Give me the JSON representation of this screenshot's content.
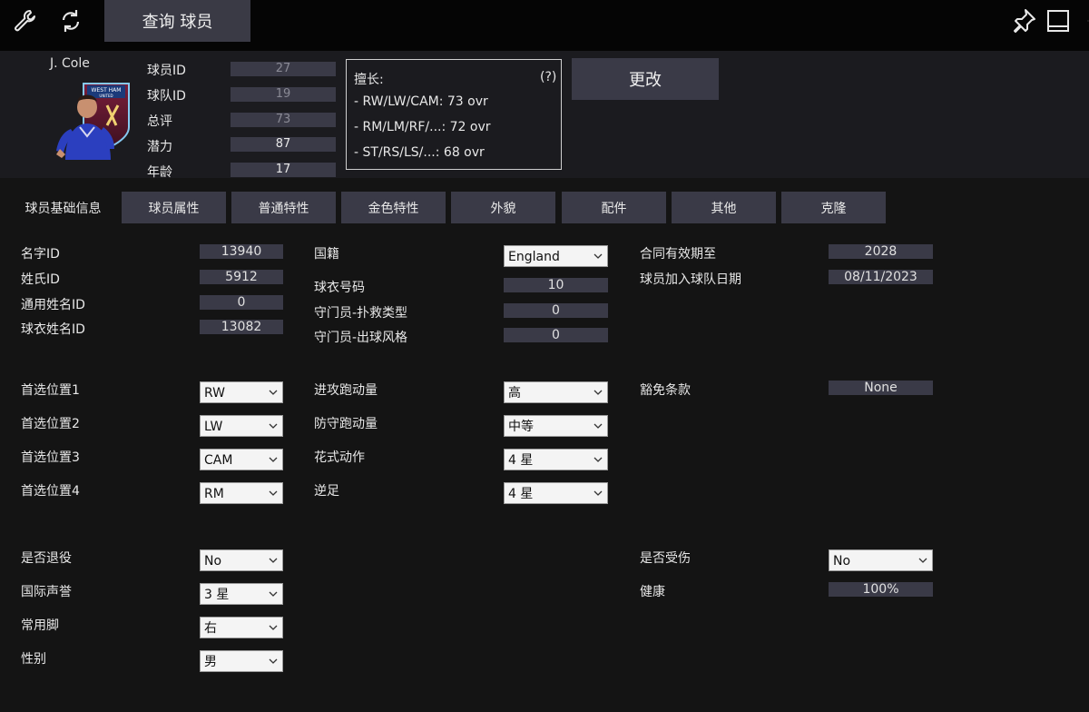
{
  "toolbar": {
    "query_label": "查询 球员",
    "icons": [
      "wrench-icon",
      "refresh-icon",
      "pin-icon",
      "window-icon"
    ]
  },
  "header": {
    "player_name": "J. Cole",
    "club_badge": {
      "line1": "WEST HAM",
      "line2": "UNITED"
    },
    "fields": [
      {
        "label": "球员ID",
        "value": "27"
      },
      {
        "label": "球队ID",
        "value": "19"
      },
      {
        "label": "总评",
        "value": "73"
      },
      {
        "label": "潜力",
        "value": "87"
      },
      {
        "label": "年龄",
        "value": "17"
      }
    ],
    "skills": {
      "title": "擅长:",
      "help": "(?)",
      "lines": [
        "- RW/LW/CAM: 73 ovr",
        "- RM/LM/RF/...: 72 ovr",
        "- ST/RS/LS/...: 68 ovr"
      ]
    },
    "change_label": "更改"
  },
  "tabs": [
    "球员基础信息",
    "球员属性",
    "普通特性",
    "金色特性",
    "外貌",
    "配件",
    "其他",
    "克隆"
  ],
  "col1": {
    "ids": [
      {
        "label": "名字ID",
        "value": "13940"
      },
      {
        "label": "姓氏ID",
        "value": "5912"
      },
      {
        "label": "通用姓名ID",
        "value": "0"
      },
      {
        "label": "球衣姓名ID",
        "value": "13082"
      }
    ],
    "positions": [
      {
        "label": "首选位置1",
        "value": "RW"
      },
      {
        "label": "首选位置2",
        "value": "LW"
      },
      {
        "label": "首选位置3",
        "value": "CAM"
      },
      {
        "label": "首选位置4",
        "value": "RM"
      }
    ],
    "misc": [
      {
        "label": "是否退役",
        "value": "No"
      },
      {
        "label": "国际声誉",
        "value": "3 星"
      },
      {
        "label": "常用脚",
        "value": "右"
      },
      {
        "label": "性别",
        "value": "男"
      }
    ]
  },
  "col2": {
    "nationality": {
      "label": "国籍",
      "value": "England"
    },
    "fields": [
      {
        "label": "球衣号码",
        "value": "10"
      },
      {
        "label": "守门员-扑救类型",
        "value": "0"
      },
      {
        "label": "守门员-出球风格",
        "value": "0"
      }
    ],
    "selects": [
      {
        "label": "进攻跑动量",
        "value": "高"
      },
      {
        "label": "防守跑动量",
        "value": "中等"
      },
      {
        "label": "花式动作",
        "value": "4 星"
      },
      {
        "label": "逆足",
        "value": "4 星"
      }
    ]
  },
  "col3": {
    "contract": {
      "label": "合同有效期至",
      "value": "2028"
    },
    "joined": {
      "label": "球员加入球队日期",
      "value": "08/11/2023"
    },
    "release": {
      "label": "豁免条款",
      "value": "None"
    },
    "injured": {
      "label": "是否受伤",
      "value": "No"
    },
    "health": {
      "label": "健康",
      "value": "100%"
    }
  }
}
